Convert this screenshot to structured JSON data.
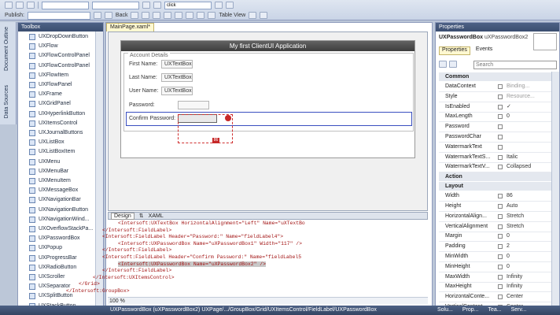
{
  "toolbar": {
    "publish": "Publish:",
    "back": "Back",
    "search_value": "click",
    "view": "Table View"
  },
  "vtabs": {
    "outline": "Document Outline",
    "sources": "Data Sources"
  },
  "toolbox": {
    "title": "Toolbox",
    "items": [
      "UXDropDownButton",
      "UXFlow",
      "UXFlowControlPanel",
      "UXFlowControlPanel",
      "UXFlowItem",
      "UXFlowPanel",
      "UXFrame",
      "UXGridPanel",
      "UXHyperlinkButton",
      "UXItemsControl",
      "UXJournalButtons",
      "UXListBox",
      "UXListBoxItem",
      "UXMenu",
      "UXMenuBar",
      "UXMenuItem",
      "UXMessageBox",
      "UXNavigationBar",
      "UXNavigationButton",
      "UXNavigationWind...",
      "UXOverflowStackPa...",
      "UXPasswordBox",
      "UXPopup",
      "UXProgressBar",
      "UXRadioButton",
      "UXScroller",
      "UXSeparator",
      "UXSplitButton",
      "UXStackButton"
    ]
  },
  "editor": {
    "tab": "MainPage.xaml*",
    "app_title": "My first ClientUI Application",
    "group": "Account Details",
    "fields": [
      {
        "label": "First Name:",
        "value": "UXTextBox"
      },
      {
        "label": "Last Name:",
        "value": "UXTextBox"
      },
      {
        "label": "User Name:",
        "value": "UXTextBox"
      },
      {
        "label": "Password:",
        "value": ""
      },
      {
        "label": "Confirm Password:",
        "value": ""
      }
    ],
    "width_badge": "86",
    "design_tab": "Design",
    "xaml_tab": "XAML",
    "zoom": "100 %"
  },
  "code": [
    {
      "pre": "<Intersoft:UXTextBox HorizontalAlignment=\"Left\" Name=\"uXTextBo"
    },
    {
      "pre": "</Intersoft:FieldLabel>"
    },
    {
      "pre": "<Intersoft:FieldLabel Header=\"Password:\" Name=\"fieldLabel4\">"
    },
    {
      "pre": "<Intersoft:UXPasswordBox Name=\"uXPasswordBox1\" Width=\"117\" />"
    },
    {
      "pre": "</Intersoft:FieldLabel>"
    },
    {
      "pre": "<Intersoft:FieldLabel Header=\"Confirm Password:\" Name=\"fieldLabel5"
    },
    {
      "pre": "<Intersoft:UXPasswordBox Name=\"uXPasswordBox2\" />"
    },
    {
      "pre": "</Intersoft:FieldLabel>"
    },
    {
      "pre": "</Intersoft:UXItemsControl>"
    },
    {
      "pre": "</Grid>"
    },
    {
      "pre": "</Intersoft:GroupBox>"
    }
  ],
  "breadcrumb": "UXPasswordBox (uXPasswordBox2)   UXPage/.../GroupBox/Grid/UXItemsControl/FieldLabel/UXPasswordBox",
  "properties": {
    "title": "Properties",
    "type": "UXPasswordBox",
    "name": "uXPasswordBox2",
    "tab_props": "Properties",
    "tab_events": "Events",
    "search": "Search",
    "rows": [
      {
        "cat": "Common"
      },
      {
        "n": "DataContext",
        "v": "Binding...",
        "gray": true
      },
      {
        "n": "Style",
        "v": "Resource...",
        "gray": true
      },
      {
        "n": "IsEnabled",
        "v": "✓"
      },
      {
        "n": "MaxLength",
        "v": "0"
      },
      {
        "n": "Password",
        "v": ""
      },
      {
        "n": "PasswordChar",
        "v": ""
      },
      {
        "n": "WatermarkText",
        "v": ""
      },
      {
        "n": "WatermarkTextS...",
        "v": "Italic"
      },
      {
        "n": "WatermarkTextV...",
        "v": "Collapsed"
      },
      {
        "cat": "Action"
      },
      {
        "cat": "Layout"
      },
      {
        "n": "Width",
        "v": "86"
      },
      {
        "n": "Height",
        "v": "Auto"
      },
      {
        "n": "HorizontalAlign...",
        "v": "Stretch"
      },
      {
        "n": "VerticalAlignment",
        "v": "Stretch"
      },
      {
        "n": "Margin",
        "v": "0"
      },
      {
        "n": "Padding",
        "v": "2"
      },
      {
        "n": "MinWidth",
        "v": "0"
      },
      {
        "n": "MinHeight",
        "v": "0"
      },
      {
        "n": "MaxWidth",
        "v": "Infinity"
      },
      {
        "n": "MaxHeight",
        "v": "Infinity"
      },
      {
        "n": "HorizontalConte...",
        "v": "Center"
      },
      {
        "n": "VerticalContent...",
        "v": "Center"
      }
    ]
  },
  "status_tabs": [
    "Solu...",
    "Prop...",
    "Tea...",
    "Serv..."
  ]
}
